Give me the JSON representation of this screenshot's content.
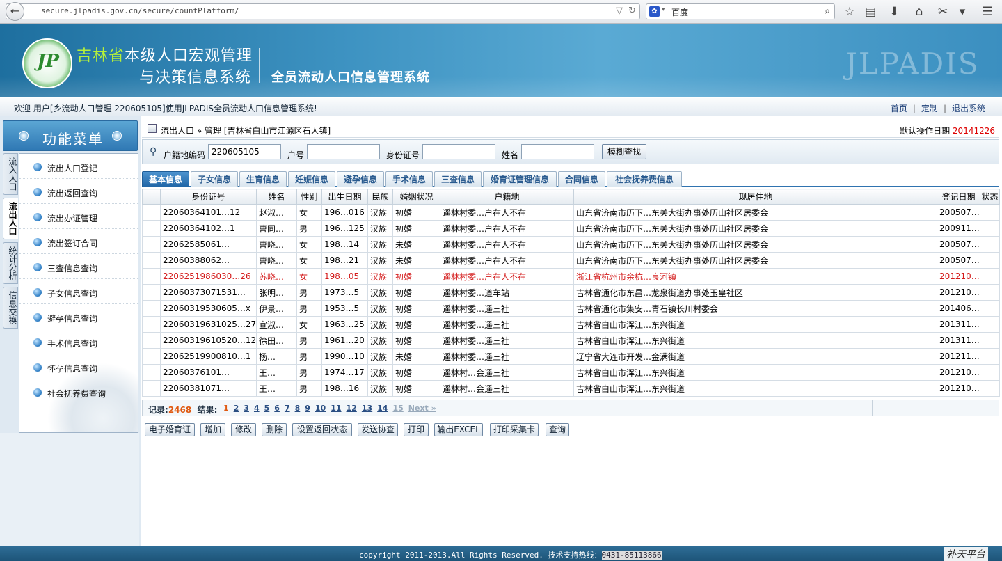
{
  "browser": {
    "url": "secure.jlpadis.gov.cn/secure/countPlatform/",
    "search_placeholder": "百度",
    "search_engine_icon": "baidu-paw-icon"
  },
  "header": {
    "title_green": "吉林省",
    "title_rest": "本级人口宏观管理",
    "title_line2": "与决策信息系统",
    "subtitle": "全员流动人口信息管理系统",
    "watermark": "JLPADIS",
    "logo_text": "JP"
  },
  "welcome": {
    "text": "欢迎 用户[乡流动人口管理 220605105]使用JLPADIS全员流动人口信息管理系统!",
    "links": [
      "首页",
      "定制",
      "退出系统"
    ]
  },
  "sidebar": {
    "title": "功能菜单",
    "tabs": [
      {
        "label": "流入人口",
        "active": false
      },
      {
        "label": "流出人口",
        "active": true
      },
      {
        "label": "统计分析",
        "active": false
      },
      {
        "label": "信息交换",
        "active": false
      }
    ],
    "items": [
      "流出人口登记",
      "流出返回查询",
      "流出办证管理",
      "流出签订合同",
      "三查信息查询",
      "子女信息查询",
      "避孕信息查询",
      "手术信息查询",
      "怀孕信息查询",
      "社会抚养费查询"
    ]
  },
  "breadcrumb": {
    "text": "流出人口 » 管理 [吉林省白山市江源区石人镇]",
    "date_label": "默认操作日期",
    "date_value": "20141226"
  },
  "filter": {
    "labels": [
      "户籍地编码",
      "户号",
      "身份证号",
      "姓名"
    ],
    "huji_code_value": "220605105",
    "search_button": "模糊查找"
  },
  "tabs": [
    "基本信息",
    "子女信息",
    "生育信息",
    "妊娠信息",
    "避孕信息",
    "手术信息",
    "三查信息",
    "婚育证管理信息",
    "合同信息",
    "社会抚养费信息"
  ],
  "table": {
    "columns": [
      "身份证号",
      "姓名",
      "性别",
      "出生日期",
      "民族",
      "婚姻状况",
      "户籍地",
      "现居住地",
      "登记日期",
      "状态"
    ],
    "rows": [
      {
        "id": "22060364101…12",
        "name": "赵淑…",
        "sex": "女",
        "birth": "196…016",
        "nation": "汉族",
        "marital": "初婚",
        "huji": "遥林村委…户在人不在",
        "addr": "山东省济南市历下…东关大街办事处历山社区居委会",
        "reg": "200507…",
        "status": ""
      },
      {
        "id": "22060364102…1",
        "name": "曹同…",
        "sex": "男",
        "birth": "196…125",
        "nation": "汉族",
        "marital": "初婚",
        "huji": "遥林村委…户在人不在",
        "addr": "山东省济南市历下…东关大街办事处历山社区居委会",
        "reg": "200911…",
        "status": ""
      },
      {
        "id": "22062585061…",
        "name": "曹晓…",
        "sex": "女",
        "birth": "198…14",
        "nation": "汉族",
        "marital": "未婚",
        "huji": "遥林村委…户在人不在",
        "addr": "山东省济南市历下…东关大街办事处历山社区居委会",
        "reg": "200507…",
        "status": ""
      },
      {
        "id": "22060388062…",
        "name": "曹晓…",
        "sex": "女",
        "birth": "198…21",
        "nation": "汉族",
        "marital": "未婚",
        "huji": "遥林村委…户在人不在",
        "addr": "山东省济南市历下…东关大街办事处历山社区居委会",
        "reg": "200507…",
        "status": ""
      },
      {
        "id": "2206251986030…26",
        "name": "苏晓…",
        "sex": "女",
        "birth": "198…05",
        "nation": "汉族",
        "marital": "初婚",
        "huji": "遥林村委…户在人不在",
        "addr": "浙江省杭州市余杭…良河镇",
        "reg": "201210…",
        "status": "",
        "highlight": true
      },
      {
        "id": "22060373071531…",
        "name": "张明…",
        "sex": "男",
        "birth": "1973…5",
        "nation": "汉族",
        "marital": "初婚",
        "huji": "遥林村委…道车站",
        "addr": "吉林省通化市东昌…龙泉街道办事处玉皇社区",
        "reg": "201210…",
        "status": ""
      },
      {
        "id": "22060319530605…x",
        "name": "伊景…",
        "sex": "男",
        "birth": "1953…5",
        "nation": "汉族",
        "marital": "初婚",
        "huji": "遥林村委…遥三社",
        "addr": "吉林省通化市集安…青石镇长川村委会",
        "reg": "201406…",
        "status": ""
      },
      {
        "id": "22060319631025…27",
        "name": "宣淑…",
        "sex": "女",
        "birth": "1963…25",
        "nation": "汉族",
        "marital": "初婚",
        "huji": "遥林村委…遥三社",
        "addr": "吉林省白山市浑江…东兴街道",
        "reg": "201311…",
        "status": ""
      },
      {
        "id": "22060319610520…12",
        "name": "徐田…",
        "sex": "男",
        "birth": "1961…20",
        "nation": "汉族",
        "marital": "初婚",
        "huji": "遥林村委…遥三社",
        "addr": "吉林省白山市浑江…东兴街道",
        "reg": "201311…",
        "status": ""
      },
      {
        "id": "22062519900810…1",
        "name": "杨…",
        "sex": "男",
        "birth": "1990…10",
        "nation": "汉族",
        "marital": "未婚",
        "huji": "遥林村委…遥三社",
        "addr": "辽宁省大连市开发…金满街道",
        "reg": "201211…",
        "status": ""
      },
      {
        "id": "22060376101…",
        "name": "王…",
        "sex": "男",
        "birth": "1974…17",
        "nation": "汉族",
        "marital": "初婚",
        "huji": "遥林村…会遥三社",
        "addr": "吉林省白山市浑江…东兴街道",
        "reg": "201210…",
        "status": ""
      },
      {
        "id": "22060381071…",
        "name": "王…",
        "sex": "男",
        "birth": "198…16",
        "nation": "汉族",
        "marital": "初婚",
        "huji": "遥林村…会遥三社",
        "addr": "吉林省白山市浑江…东兴街道",
        "reg": "201210…",
        "status": ""
      }
    ]
  },
  "pager": {
    "records_label": "记录:",
    "records_value": "2468",
    "results_label": "结果:",
    "pages": [
      "1",
      "2",
      "3",
      "4",
      "5",
      "6",
      "7",
      "8",
      "9",
      "10",
      "11",
      "12",
      "13",
      "14",
      "15",
      "Next »"
    ]
  },
  "actions": [
    "电子婚育证",
    "增加",
    "修改",
    "删除",
    "设置返回状态",
    "发送协查",
    "打印",
    "输出EXCEL",
    "打印采集卡",
    "查询"
  ],
  "footer": {
    "text": "copyright 2011-2013.All Rights Reserved. 技术支持热线：",
    "hotline": "0431-85113866",
    "signature": "补天平台"
  }
}
